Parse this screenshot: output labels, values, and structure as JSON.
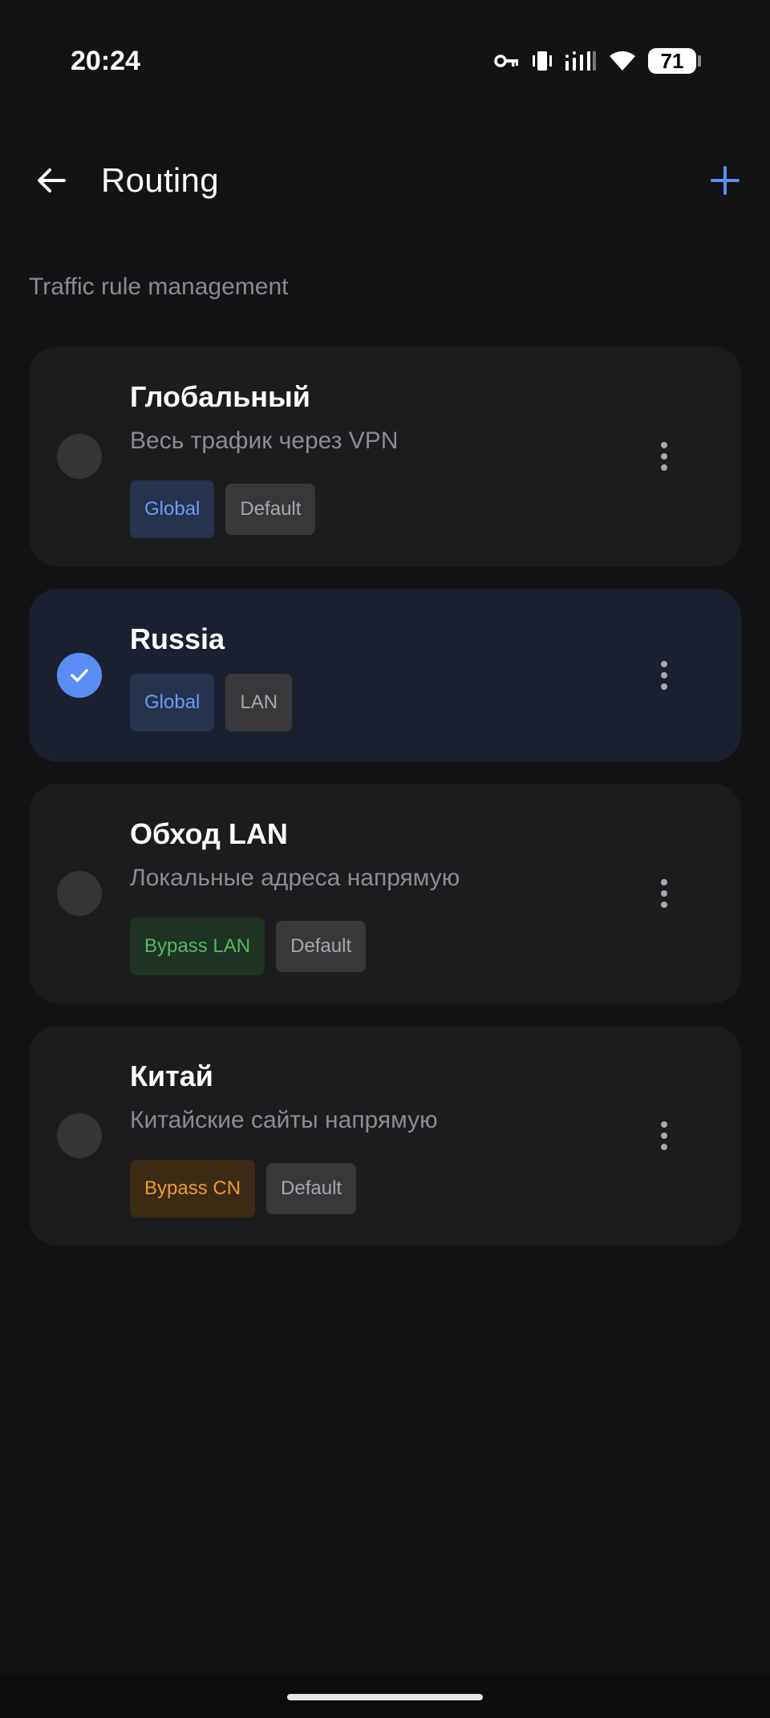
{
  "status_bar": {
    "time": "20:24",
    "battery": "71",
    "icons": [
      "vpn-key-icon",
      "vibrate-icon",
      "signal-icon",
      "wifi-icon",
      "battery-icon"
    ]
  },
  "header": {
    "title": "Routing",
    "back_icon": "arrow-left-icon",
    "add_icon": "plus-icon",
    "accent_color": "#5a8ef5"
  },
  "subtitle": "Traffic rule management",
  "rules": [
    {
      "title": "Глобальный",
      "description": "Весь трафик через VPN",
      "selected": false,
      "tags": [
        {
          "label": "Global",
          "color": "blue"
        },
        {
          "label": "Default",
          "color": "gray"
        }
      ]
    },
    {
      "title": "Russia",
      "description": "",
      "selected": true,
      "tags": [
        {
          "label": "Global",
          "color": "blue"
        },
        {
          "label": "LAN",
          "color": "gray"
        }
      ]
    },
    {
      "title": "Обход LAN",
      "description": "Локальные адреса напрямую",
      "selected": false,
      "tags": [
        {
          "label": "Bypass LAN",
          "color": "green"
        },
        {
          "label": "Default",
          "color": "gray"
        }
      ]
    },
    {
      "title": "Китай",
      "description": "Китайские сайты напрямую",
      "selected": false,
      "tags": [
        {
          "label": "Bypass CN",
          "color": "orange"
        },
        {
          "label": "Default",
          "color": "gray"
        }
      ]
    }
  ]
}
